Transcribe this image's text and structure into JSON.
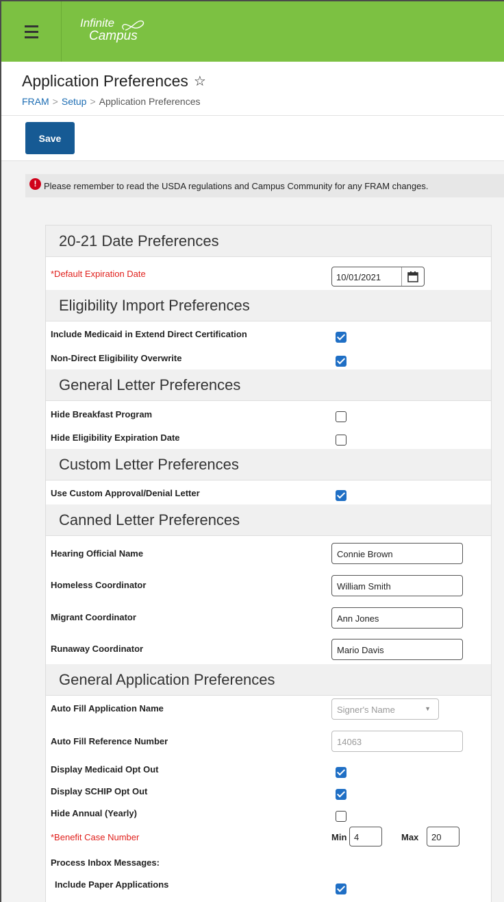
{
  "app": {
    "logo_line1": "Infinite",
    "logo_line2": "Campus"
  },
  "header": {
    "title": "Application Preferences",
    "breadcrumb": [
      "FRAM",
      "Setup",
      "Application Preferences"
    ]
  },
  "toolbar": {
    "save_label": "Save"
  },
  "alert": {
    "text": "Please remember to read the USDA regulations and Campus Community for any FRAM changes."
  },
  "sections": {
    "date": {
      "title": "20-21 Date Preferences",
      "default_expiration_label": "*Default Expiration Date",
      "default_expiration_value": "10/01/2021"
    },
    "eligibility": {
      "title": "Eligibility Import Preferences",
      "include_medicaid_label": "Include Medicaid in Extend Direct Certification",
      "include_medicaid_checked": true,
      "non_direct_label": "Non-Direct Eligibility Overwrite",
      "non_direct_checked": true
    },
    "general_letter": {
      "title": "General Letter Preferences",
      "hide_breakfast_label": "Hide Breakfast Program",
      "hide_breakfast_checked": false,
      "hide_expiration_label": "Hide Eligibility Expiration Date",
      "hide_expiration_checked": false
    },
    "custom_letter": {
      "title": "Custom Letter Preferences",
      "use_custom_label": "Use Custom Approval/Denial Letter",
      "use_custom_checked": true
    },
    "canned_letter": {
      "title": "Canned Letter Preferences",
      "hearing_label": "Hearing Official Name",
      "hearing_value": "Connie Brown",
      "homeless_label": "Homeless Coordinator",
      "homeless_value": "William Smith",
      "migrant_label": "Migrant Coordinator",
      "migrant_value": "Ann Jones",
      "runaway_label": "Runaway Coordinator",
      "runaway_value": "Mario Davis"
    },
    "general_application": {
      "title": "General Application Preferences",
      "auto_fill_name_label": "Auto Fill Application Name",
      "auto_fill_name_value": "Signer's Name",
      "auto_fill_ref_label": "Auto Fill Reference Number",
      "auto_fill_ref_value": "14063",
      "medicaid_opt_out_label": "Display Medicaid Opt Out",
      "medicaid_opt_out_checked": true,
      "schip_opt_out_label": "Display SCHIP Opt Out",
      "schip_opt_out_checked": true,
      "hide_annual_label": "Hide Annual (Yearly)",
      "hide_annual_checked": false,
      "benefit_case_label": "*Benefit Case Number",
      "min_label": "Min",
      "min_value": "4",
      "max_label": "Max",
      "max_value": "20",
      "process_inbox_label": "Process Inbox Messages:",
      "include_paper_label": "Include Paper Applications",
      "include_paper_checked": true
    }
  },
  "colors": {
    "topbar": "#7cc142",
    "save_button": "#165a94",
    "required": "#e0201c",
    "checkbox_checked": "#1f6fc5",
    "link": "#1b6cb3"
  }
}
